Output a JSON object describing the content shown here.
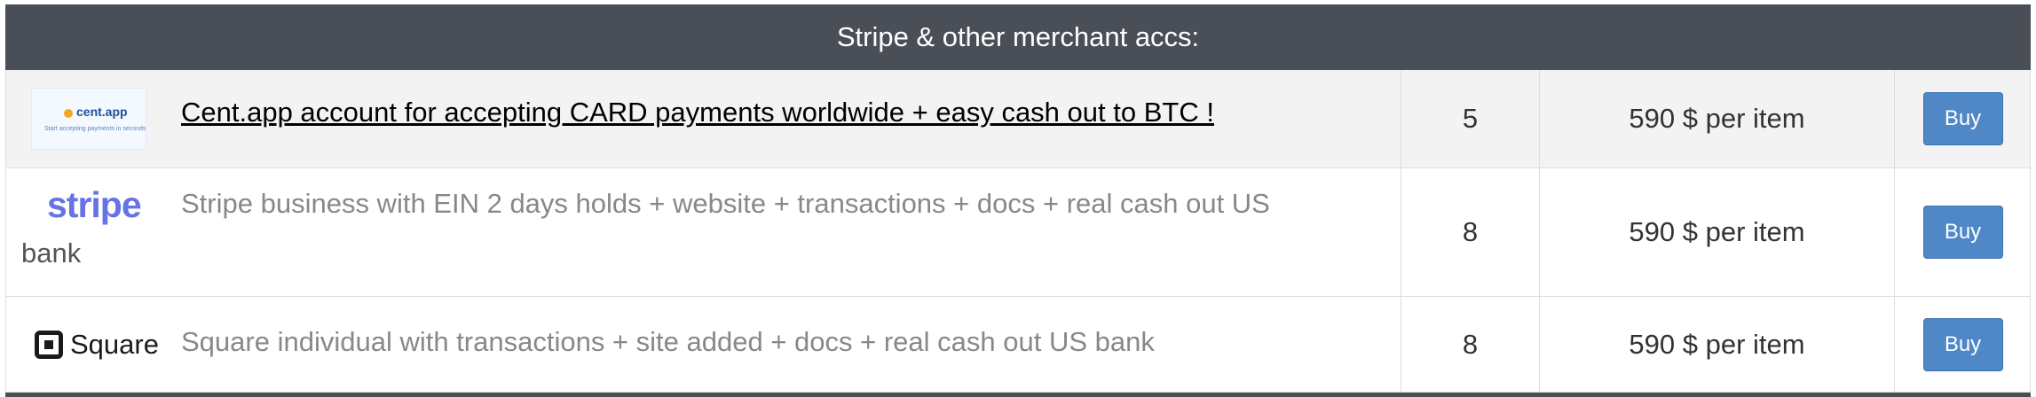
{
  "header": {
    "title": "Stripe & other merchant accs:"
  },
  "rows": [
    {
      "logo": {
        "name": "cent.app",
        "tagline": "Start accepting payments in seconds"
      },
      "description": "Cent.app account for accepting CARD payments worldwide + easy cash out to BTC !",
      "quantity": "5",
      "price": "590 $ per item",
      "buy_label": "Buy"
    },
    {
      "logo": {
        "name": "stripe"
      },
      "description": "Stripe business with EIN 2 days holds + website + transactions + docs + real cash out US",
      "description_wrap": "bank",
      "quantity": "8",
      "price": "590 $ per item",
      "buy_label": "Buy"
    },
    {
      "logo": {
        "name": "Square"
      },
      "description": "Square individual with transactions + site added + docs + real cash out US bank",
      "quantity": "8",
      "price": "590 $ per item",
      "buy_label": "Buy"
    }
  ],
  "colors": {
    "header_bg": "#4a4f57",
    "button_bg": "#4f87c7",
    "stripe_brand": "#6772e5"
  }
}
